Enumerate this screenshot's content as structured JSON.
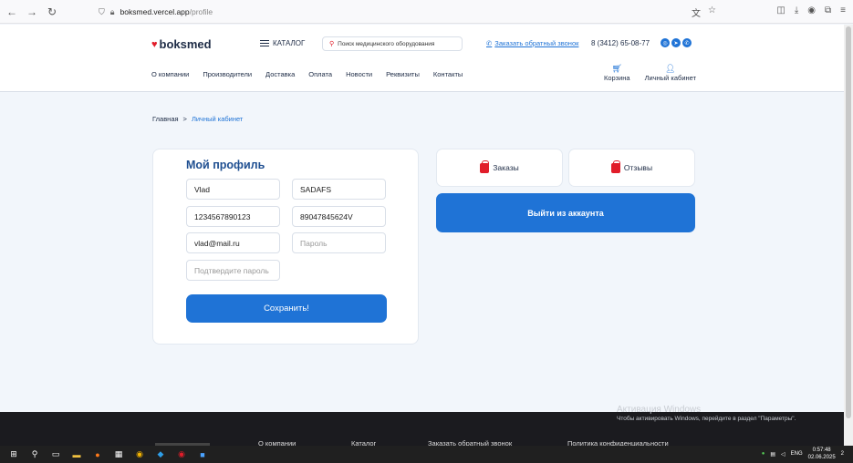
{
  "browser": {
    "back": "←",
    "forward": "→",
    "reload": "↻",
    "url_host": "boksmed.vercel.app",
    "url_path": "/profile"
  },
  "header": {
    "logo_text": "boksmed",
    "catalog_label": "КАТАЛОГ",
    "search_placeholder": "Поиск медицинского оборудования",
    "callback_label": "Заказать обратный звонок",
    "phone": "8 (3412) 65-08-77",
    "menu": [
      "О компании",
      "Производители",
      "Доставка",
      "Оплата",
      "Новости",
      "Реквизиты",
      "Контакты"
    ],
    "cart_label": "Корзина",
    "account_label": "Личный кабинет"
  },
  "breadcrumb": {
    "home": "Главная",
    "separator": ">",
    "current": "Личный кабинет"
  },
  "profile": {
    "title": "Мой профиль",
    "fields": {
      "first_name": "Vlad",
      "last_name": "SADAFS",
      "inn": "1234567890123",
      "phone": "89047845624V",
      "email": "vlad@mail.ru",
      "password_placeholder": "Пароль",
      "confirm_placeholder": "Подтвердите пароль"
    },
    "save_label": "Сохранить!"
  },
  "account": {
    "orders_label": "Заказы",
    "reviews_label": "Отзывы",
    "logout_label": "Выйти из аккаунта"
  },
  "watermark": {
    "title": "Активация Windows",
    "subtitle": "Чтобы активировать Windows, перейдите в раздел \"Параметры\"."
  },
  "footer": {
    "items": [
      "О компании",
      "Каталог",
      "Заказать обратный звонок",
      "Политика конфиденциальности"
    ]
  },
  "taskbar": {
    "lang": "ENG",
    "time": "0:57:48",
    "date": "02.06.2025",
    "notifications": "2"
  },
  "colors": {
    "brand_blue": "#1f73d6",
    "brand_red": "#e11d2a",
    "title_blue": "#1f4f91"
  }
}
